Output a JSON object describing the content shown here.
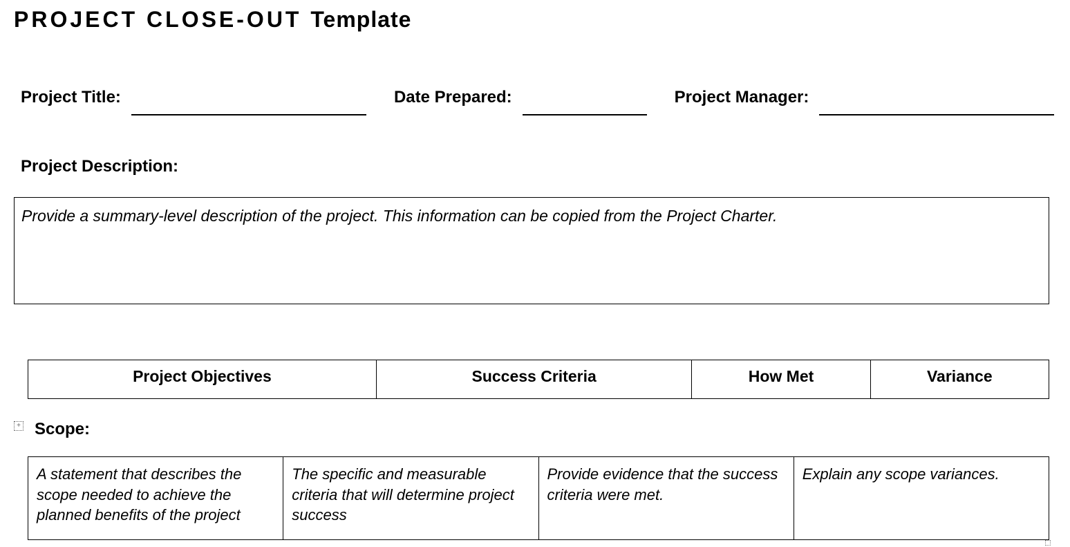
{
  "title": {
    "bold_part": "PROJECT CLOSE-OUT",
    "normal_part": "Template"
  },
  "header_fields": {
    "project_title_label": "Project Title:",
    "date_prepared_label": "Date Prepared:",
    "project_manager_label": "Project Manager:"
  },
  "description": {
    "label": "Project Description:",
    "placeholder": "Provide a summary-level description of the project.  This information can be copied from the Project Charter."
  },
  "objectives_table": {
    "headers": [
      "Project Objectives",
      "Success Criteria",
      "How Met",
      "Variance"
    ]
  },
  "scope": {
    "label": "Scope:",
    "cells": [
      "A statement that describes the scope needed to achieve the planned benefits of the project",
      "The specific and measurable criteria that will determine project success",
      "Provide evidence that the success criteria were met.",
      "Explain any scope variances."
    ]
  }
}
